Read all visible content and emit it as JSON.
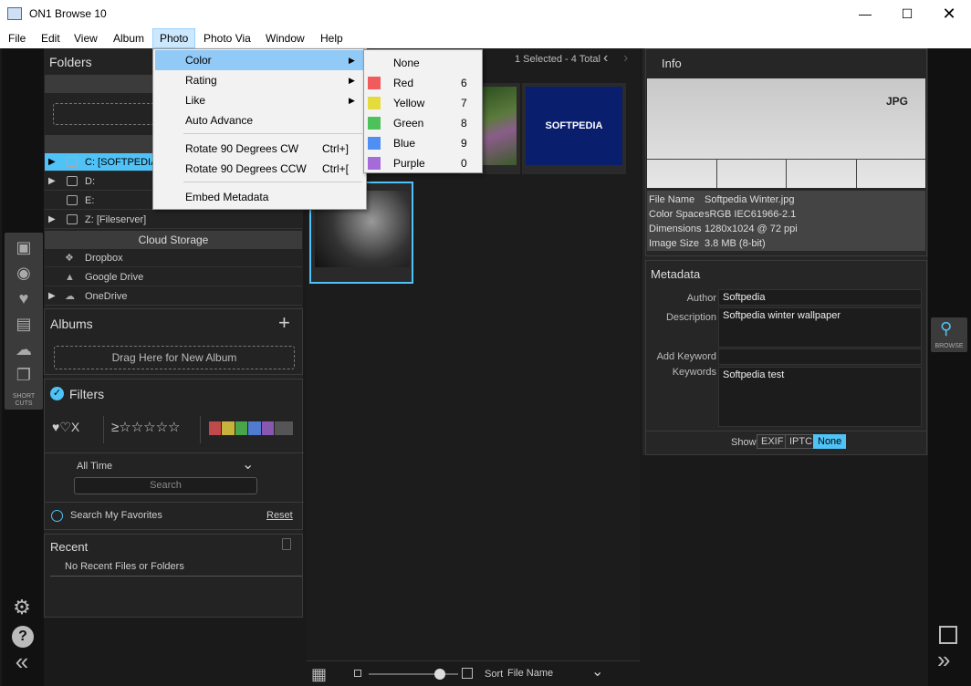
{
  "window": {
    "title": "ON1 Browse 10"
  },
  "menubar": {
    "items": [
      "File",
      "Edit",
      "View",
      "Album",
      "Photo",
      "Photo Via",
      "Window",
      "Help"
    ]
  },
  "photo_menu": {
    "items": [
      {
        "label": "Color",
        "shortcut": "",
        "submenu": true
      },
      {
        "label": "Rating",
        "shortcut": "",
        "submenu": true
      },
      {
        "label": "Like",
        "shortcut": "",
        "submenu": true
      },
      {
        "label": "Auto Advance",
        "shortcut": ""
      },
      {
        "label": "Rotate 90 Degrees CW",
        "shortcut": "Ctrl+]"
      },
      {
        "label": "Rotate 90 Degrees CCW",
        "shortcut": "Ctrl+["
      },
      {
        "label": "Embed Metadata",
        "shortcut": ""
      }
    ]
  },
  "color_submenu": {
    "items": [
      {
        "label": "None",
        "key": "",
        "color": ""
      },
      {
        "label": "Red",
        "key": "6",
        "color": "#f25b5b"
      },
      {
        "label": "Yellow",
        "key": "7",
        "color": "#e4dc3a"
      },
      {
        "label": "Green",
        "key": "8",
        "color": "#4cc35a"
      },
      {
        "label": "Blue",
        "key": "9",
        "color": "#4f8ef2"
      },
      {
        "label": "Purple",
        "key": "0",
        "color": "#a56cd9"
      }
    ]
  },
  "left_panel": {
    "folders_title": "Folders",
    "favorites_header": "Favo",
    "favorites_drop": "Drop Yo",
    "locations_header": "Lo",
    "drives": [
      {
        "label": "C: [SOFTPEDIA]",
        "expandable": true,
        "selected": true
      },
      {
        "label": "D:",
        "expandable": true
      },
      {
        "label": "E:",
        "expandable": false
      },
      {
        "label": "Z: [Fileserver]",
        "expandable": true
      }
    ],
    "cloud_header": "Cloud Storage",
    "cloud": [
      {
        "label": "Dropbox",
        "expandable": false
      },
      {
        "label": "Google Drive",
        "expandable": false
      },
      {
        "label": "OneDrive",
        "expandable": true
      }
    ],
    "albums_title": "Albums",
    "albums_drop": "Drag Here for New Album",
    "filters_title": "Filters",
    "filter_like": "♥♡X",
    "filter_rating": "≥☆☆☆☆☆",
    "filter_colors": [
      "#c0494b",
      "#c7b23c",
      "#4aa54a",
      "#4f7bd1",
      "#8857b0",
      "#555555"
    ],
    "time_select": "All Time",
    "search_placeholder": "Search",
    "search_favorites": "Search My Favorites",
    "reset": "Reset",
    "recent_title": "Recent",
    "recent_empty": "No Recent Files or Folders"
  },
  "left_rail": {
    "shortcuts_label": "SHORT CUTS"
  },
  "center": {
    "status": "1 Selected - 4 Total",
    "sort_label": "Sort",
    "sort_value": "File Name",
    "zoom_level": 0.8,
    "thumb_label": "SOFTPEDIA"
  },
  "info": {
    "title": "Info",
    "file_type": "JPG",
    "rows": [
      {
        "label": "File Name",
        "value": "Softpedia Winter.jpg"
      },
      {
        "label": "Color Space",
        "value": "sRGB IEC61966-2.1"
      },
      {
        "label": "Dimensions",
        "value": "1280x1024 @ 72 ppi"
      },
      {
        "label": "Image Size",
        "value": "3.8 MB (8-bit)"
      }
    ]
  },
  "metadata": {
    "title": "Metadata",
    "author_label": "Author",
    "author": "Softpedia",
    "description_label": "Description",
    "description": "Softpedia winter wallpaper",
    "add_keyword_label": "Add Keyword",
    "keywords_label": "Keywords",
    "keywords": "Softpedia test",
    "show_label": "Show",
    "show_options": [
      "EXIF",
      "IPTC",
      "None"
    ],
    "show_selected": "None"
  },
  "right_rail": {
    "browse_label": "BROWSE"
  }
}
